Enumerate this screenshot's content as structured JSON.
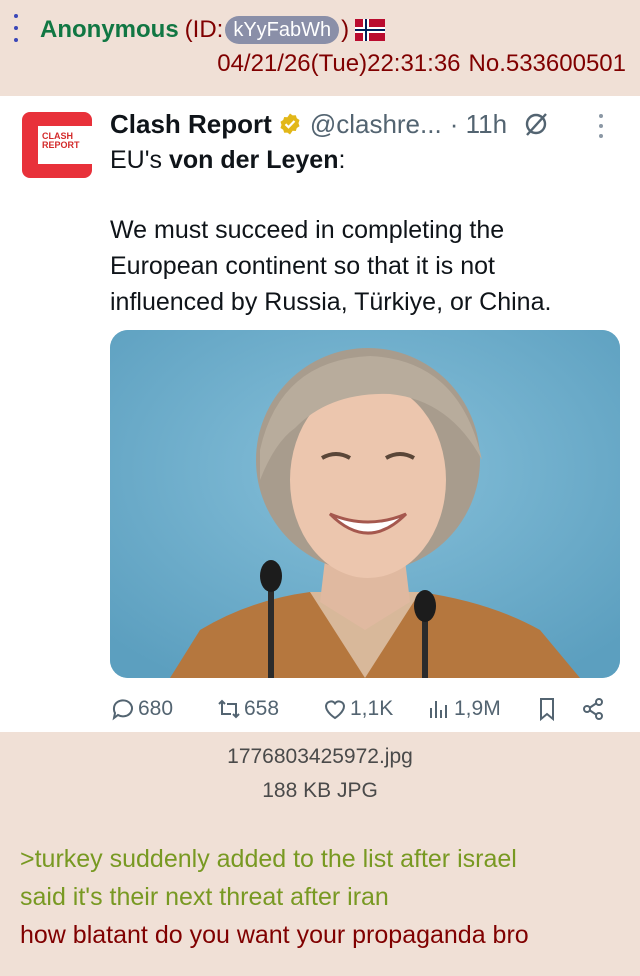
{
  "post": {
    "menu_icon": "vertical-dots-icon",
    "name": "Anonymous",
    "id_prefix": "(ID:",
    "id_value": "kYyFabWh",
    "id_suffix": ")",
    "flag": "norway-flag",
    "date": "04/21/26(Tue)22:31:36",
    "number": "No.533600501"
  },
  "tweet": {
    "avatar_text": "CLASH REPORT",
    "display_name": "Clash Report",
    "verified_color": "#e2b719",
    "handle": "@clashre...",
    "time": "· 11h",
    "headline_prefix": "EU's",
    "headline_bold": "von der Leyen",
    "headline_suffix": ":",
    "body_lines": [
      "We must succeed in completing the",
      "European continent so that it is not",
      "influenced by Russia, Türkiye, or China."
    ],
    "photo_description_icon": "photo-portrait",
    "actions": {
      "replies": "680",
      "reposts": "658",
      "likes": "1,1K",
      "views": "1,9M"
    }
  },
  "file": {
    "name": "1776803425972.jpg",
    "meta": "188 KB JPG"
  },
  "body": {
    "greentext": [
      ">turkey suddenly added to the list after israel",
      "said it's their next threat after iran"
    ],
    "message": "how blatant do you want your propaganda bro"
  },
  "colors": {
    "background": "#f0e0d6",
    "name": "#117743",
    "header_text": "#800000",
    "greentext": "#789922",
    "brand_red": "#e8313a"
  }
}
